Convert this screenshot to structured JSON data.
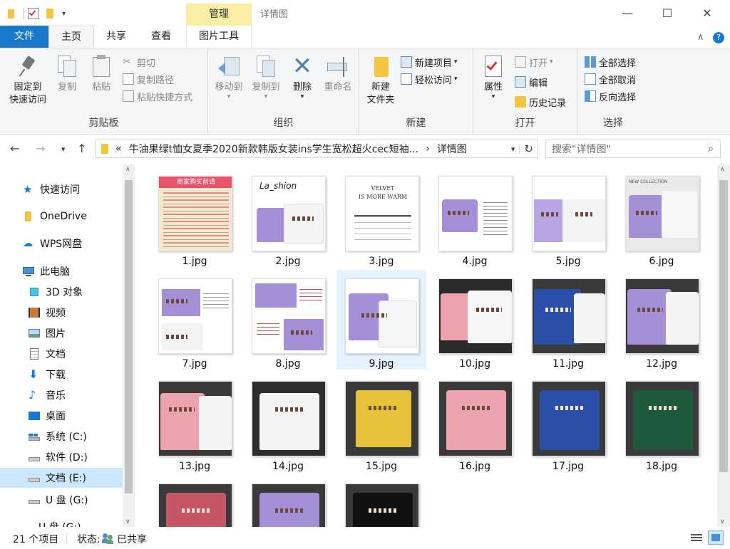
{
  "window": {
    "title": "详情图",
    "context_tab": "管理",
    "minimize": "—",
    "maximize": "☐",
    "close": "✕"
  },
  "tabs": {
    "file": "文件",
    "home": "主页",
    "share": "共享",
    "view": "查看",
    "picture_tools": "图片工具",
    "collapse": "∧",
    "help": "?"
  },
  "ribbon": {
    "clipboard": {
      "label": "剪贴板",
      "pin_line1": "固定到",
      "pin_line2": "快速访问",
      "copy": "复制",
      "paste": "粘贴",
      "cut": "剪切",
      "copy_path": "复制路径",
      "paste_shortcut": "粘贴快捷方式"
    },
    "organize": {
      "label": "组织",
      "move_to": "移动到",
      "copy_to": "复制到",
      "delete": "删除",
      "rename": "重命名"
    },
    "new": {
      "label": "新建",
      "new_folder_line1": "新建",
      "new_folder_line2": "文件夹",
      "new_item": "新建项目",
      "easy_access": "轻松访问"
    },
    "open": {
      "label": "打开",
      "properties": "属性",
      "open": "打开",
      "edit": "编辑",
      "history": "历史记录"
    },
    "select": {
      "label": "选择",
      "select_all": "全部选择",
      "select_none": "全部取消",
      "invert": "反向选择"
    }
  },
  "address": {
    "prefix": "«",
    "path": "牛油果绿t恤女夏季2020新款韩版女装ins学生宽松超火cec短袖...",
    "separator": "›",
    "current": "详情图",
    "search_placeholder": "搜索\"详情图\""
  },
  "sidebar": {
    "items": [
      {
        "label": "快速访问"
      },
      {
        "label": "OneDrive"
      },
      {
        "label": "WPS网盘"
      },
      {
        "label": "此电脑"
      },
      {
        "label": "3D 对象"
      },
      {
        "label": "视频"
      },
      {
        "label": "图片"
      },
      {
        "label": "文档"
      },
      {
        "label": "下载"
      },
      {
        "label": "音乐"
      },
      {
        "label": "桌面"
      },
      {
        "label": "系统 (C:)"
      },
      {
        "label": "软件 (D:)"
      },
      {
        "label": "文档 (E:)"
      },
      {
        "label": "U 盘 (G:)"
      },
      {
        "label": "U 盘 (G:)"
      }
    ]
  },
  "thumb_text": {
    "t1": "商家购买前请",
    "t2": "La_shion",
    "t3a": "VELVET",
    "t3b": "IS MORE WARM",
    "t6": "NEW COLLECTION"
  },
  "files": [
    {
      "name": "1.jpg"
    },
    {
      "name": "2.jpg"
    },
    {
      "name": "3.jpg"
    },
    {
      "name": "4.jpg"
    },
    {
      "name": "5.jpg"
    },
    {
      "name": "6.jpg"
    },
    {
      "name": "7.jpg"
    },
    {
      "name": "8.jpg"
    },
    {
      "name": "9.jpg"
    },
    {
      "name": "10.jpg"
    },
    {
      "name": "11.jpg"
    },
    {
      "name": "12.jpg"
    },
    {
      "name": "13.jpg"
    },
    {
      "name": "14.jpg"
    },
    {
      "name": "15.jpg"
    },
    {
      "name": "16.jpg"
    },
    {
      "name": "17.jpg"
    },
    {
      "name": "18.jpg"
    },
    {
      "name": ""
    },
    {
      "name": ""
    },
    {
      "name": ""
    }
  ],
  "status": {
    "count": "21 个项目",
    "state_label": "状态:",
    "state_value": "已共享"
  },
  "colors": {
    "accent": "#1979ca",
    "manage_tab": "#f9eea4",
    "selection": "#cce8ff",
    "lavender": "#a58fd6",
    "pink": "#eda3ad",
    "blue": "#2a4fa8",
    "yellow": "#e6c23a",
    "green": "#1f5a3c",
    "red": "#c65565"
  }
}
